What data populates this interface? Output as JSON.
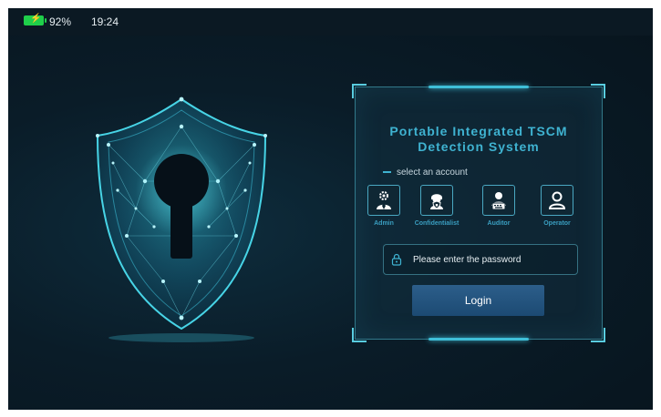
{
  "status_bar": {
    "battery_percent": "92%",
    "time": "19:24",
    "battery_icon": "battery-charging-icon"
  },
  "login_panel": {
    "title": "Portable Integrated TSCM Detection System",
    "select_label": "select an account",
    "accounts": [
      {
        "label": "Admin",
        "icon": "admin-user-gear-icon"
      },
      {
        "label": "Confidentialist",
        "icon": "shield-lock-user-icon"
      },
      {
        "label": "Auditor",
        "icon": "auditor-user-keyboard-icon"
      },
      {
        "label": "Operator",
        "icon": "operator-user-icon"
      }
    ],
    "password_placeholder": "Please enter the password",
    "login_label": "Login"
  },
  "colors": {
    "accent": "#3fb3d1",
    "background": "#0a1c28",
    "button": "#1f4e7a",
    "battery": "#1fcf4a"
  },
  "decor": {
    "shield_icon": "keyhole-shield-icon"
  }
}
